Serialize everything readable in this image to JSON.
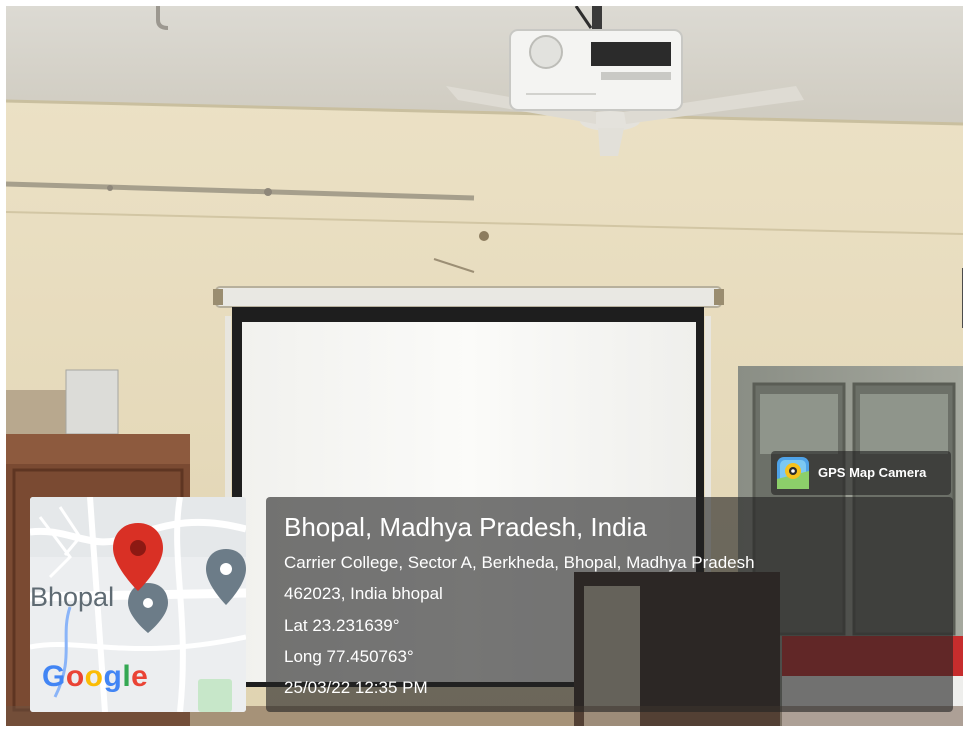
{
  "photo": {
    "subject": "classroom wall with projection screen"
  },
  "map_thumbnail": {
    "city_label": "Bhopal",
    "logo_letters": [
      "G",
      "o",
      "o",
      "g",
      "l",
      "e"
    ],
    "logo_colors": [
      "#4285f4",
      "#ea4335",
      "#fbbc05",
      "#4285f4",
      "#34a853",
      "#ea4335"
    ],
    "pin_color": "#d93025"
  },
  "badge": {
    "label": "GPS Map Camera",
    "icon": "gps-map-camera-icon"
  },
  "info": {
    "title": "Bhopal, Madhya Pradesh, India",
    "address_line1": "Carrier College, Sector A, Berkheda, Bhopal, Madhya Pradesh",
    "address_line2": "462023, India bhopal",
    "lat": "Lat 23.231639°",
    "long": "Long 77.450763°",
    "datetime": "25/03/22 12:35 PM"
  }
}
